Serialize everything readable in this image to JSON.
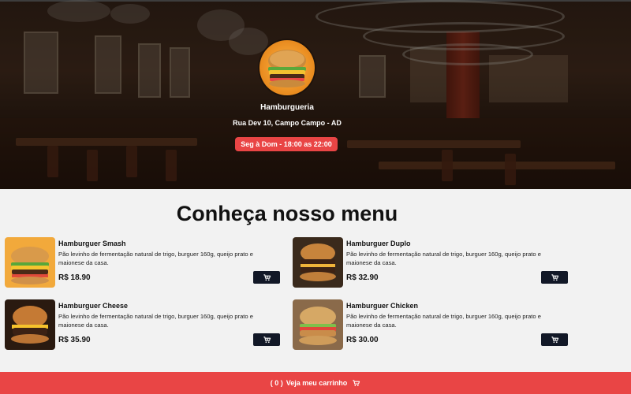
{
  "header": {
    "title": "Hamburgueria",
    "address": "Rua Dev 10, Campo Campo - AD",
    "hours": "Seg à Dom - 18:00 as 22:00"
  },
  "menu": {
    "title": "Conheça nosso menu",
    "items": [
      {
        "name": "Hamburguer Smash",
        "description": "Pão levinho de fermentação natural de trigo, burguer 160g, queijo prato e maionese da casa.",
        "price": "R$ 18.90"
      },
      {
        "name": "Hamburguer Duplo",
        "description": "Pão levinho de fermentação natural de trigo, burguer 160g, queijo prato e maionese da casa.",
        "price": "R$ 32.90"
      },
      {
        "name": "Hamburguer Cheese",
        "description": "Pão levinho de fermentação natural de trigo, burguer 160g, queijo prato e maionese da casa.",
        "price": "R$ 35.90"
      },
      {
        "name": "Hamburguer Chicken",
        "description": "Pão levinho de fermentação natural de trigo, burguer 160g, queijo prato e maionese da casa.",
        "price": "R$ 30.00"
      }
    ]
  },
  "footer": {
    "cart_count": "( 0 )",
    "cart_label": "Veja meu carrinho"
  },
  "colors": {
    "accent": "#e94545",
    "button_dark": "#121827",
    "background": "#f2f2f2"
  },
  "icons": {
    "cart": "shopping-cart-icon"
  }
}
